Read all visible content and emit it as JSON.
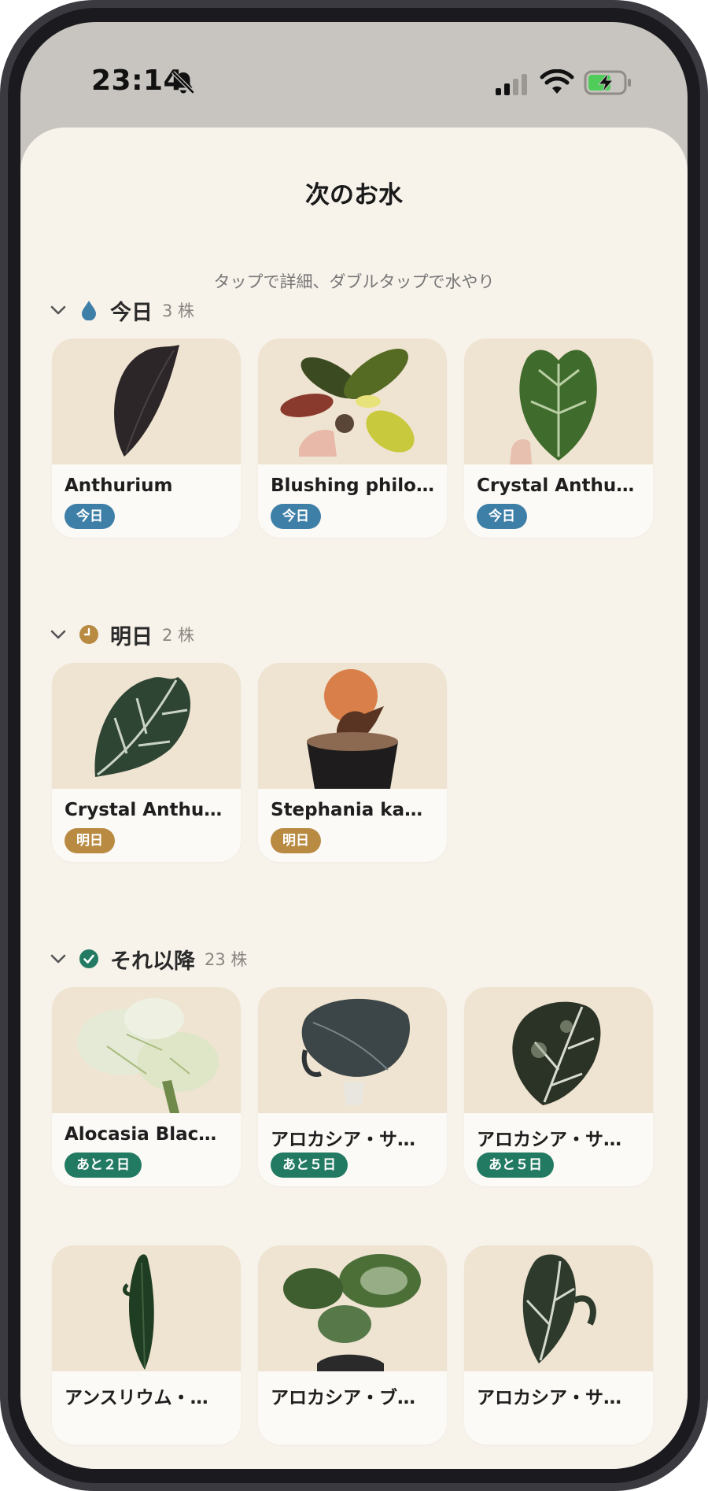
{
  "status_bar": {
    "time": "23:14"
  },
  "sheet": {
    "title": "次のお水",
    "hint": "タップで詳細、ダブルタップで水やり"
  },
  "sections": [
    {
      "title": "今日",
      "count": "3 株",
      "cards": [
        {
          "name": "Anthurium",
          "badge": "今日"
        },
        {
          "name": "Blushing philo…",
          "badge": "今日"
        },
        {
          "name": "Crystal Anthu…",
          "badge": "今日"
        }
      ]
    },
    {
      "title": "明日",
      "count": "2 株",
      "cards": [
        {
          "name": "Crystal Anthu…",
          "badge": "明日"
        },
        {
          "name": "Stephania ka…",
          "badge": "明日"
        }
      ]
    },
    {
      "title": "それ以降",
      "count": "23 株",
      "cards": [
        {
          "name": "Alocasia Blac…",
          "badge": "あと２日"
        },
        {
          "name": "アロカシア・サ…",
          "badge": "あと５日"
        },
        {
          "name": "アロカシア・サ…",
          "badge": "あと５日"
        },
        {
          "name": "アンスリウム・…",
          "badge": ""
        },
        {
          "name": "アロカシア・ブ…",
          "badge": ""
        },
        {
          "name": "アロカシア・サ…",
          "badge": ""
        }
      ]
    }
  ],
  "colors": {
    "today_badge": "#3e7fa8",
    "tomorrow_badge": "#b88a42",
    "later_badge": "#237a63",
    "sheet_background": "#f7f2ea",
    "card_image_background": "#efe3d1"
  }
}
